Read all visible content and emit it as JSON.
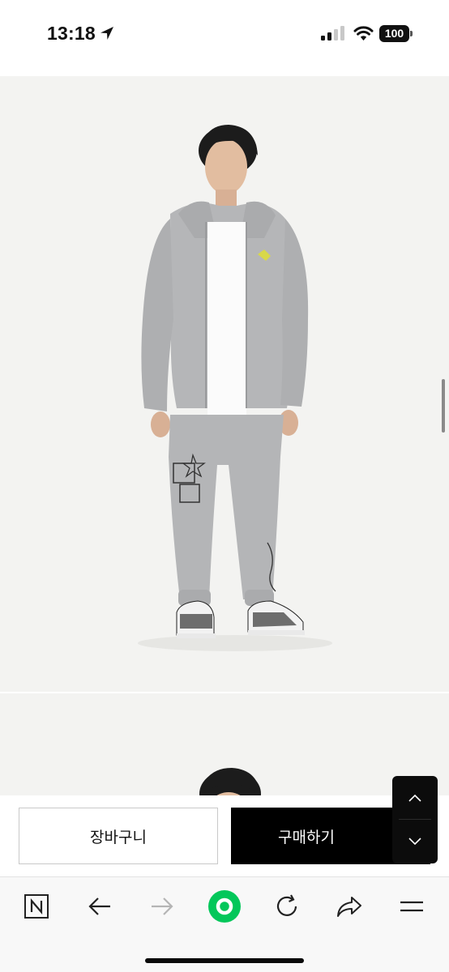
{
  "status_bar": {
    "time": "13:18",
    "battery": "100",
    "icons": [
      "location-arrow-icon",
      "cellular-signal-icon",
      "wifi-icon",
      "battery-icon"
    ]
  },
  "product": {
    "images": [
      "model wearing grey zip-up hoodie and grey printed jogger pants, front view",
      "second product photo, partially visible"
    ]
  },
  "actions": {
    "cart_label": "장바구니",
    "buy_label": "구매하기"
  },
  "scroll_controls": {
    "up_icon": "chevron-up-icon",
    "down_icon": "chevron-down-icon"
  },
  "browser_toolbar": {
    "items": [
      "naver-home-icon",
      "back-arrow-icon",
      "forward-arrow-icon",
      "green-dot-icon",
      "reload-icon",
      "share-icon",
      "menu-icon"
    ],
    "accent": "#03c75a"
  }
}
